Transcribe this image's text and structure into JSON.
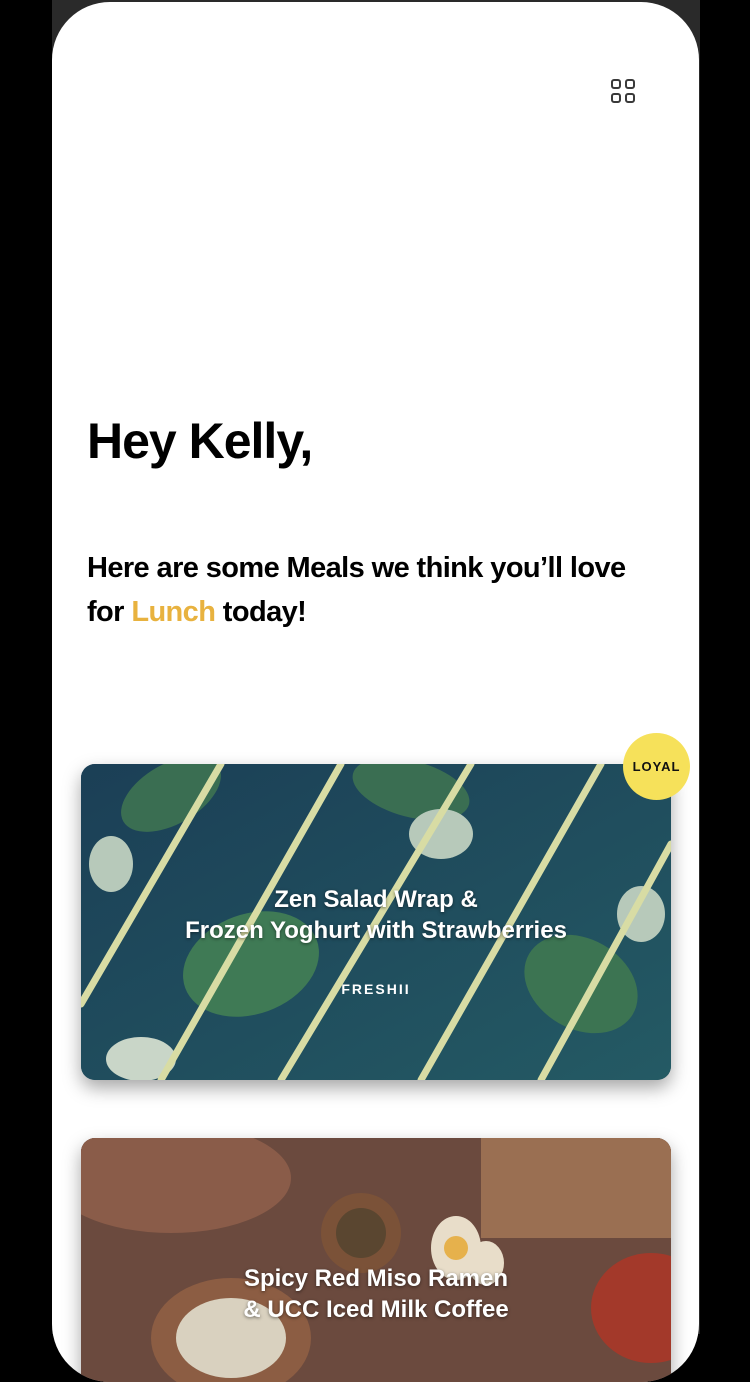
{
  "header": {
    "menu_icon": "grid-icon"
  },
  "greeting": "Hey Kelly,",
  "subtitle": {
    "before": "Here are some Meals we think you’ll love for ",
    "highlight": "Lunch",
    "after": " today!",
    "highlight_color": "#e8b23f"
  },
  "meals": [
    {
      "title_line1": "Zen Salad Wrap &",
      "title_line2": "Frozen Yoghurt with Strawberries",
      "brand": "FRESHII",
      "badge": "LOYAL",
      "badge_color": "#f6e15a"
    },
    {
      "title_line1": "Spicy Red Miso Ramen",
      "title_line2": "& UCC Iced Milk Coffee"
    }
  ]
}
